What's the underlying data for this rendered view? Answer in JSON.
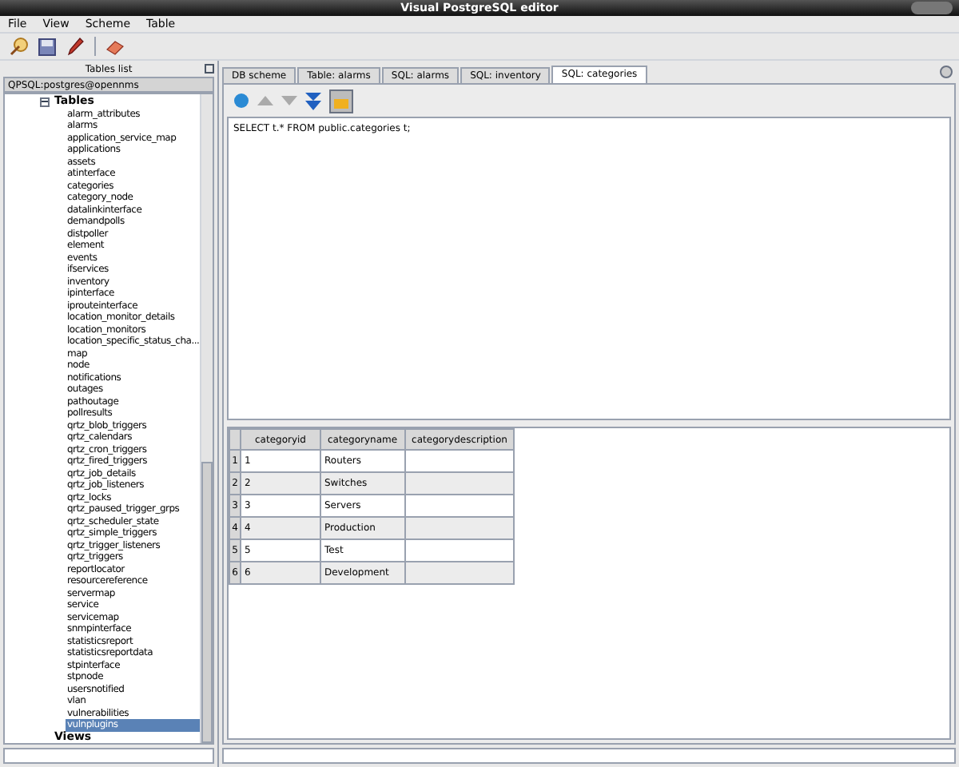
{
  "window": {
    "title": "Visual PostgreSQL editor"
  },
  "menu": [
    "File",
    "View",
    "Scheme",
    "Table"
  ],
  "sidebar": {
    "title": "Tables list",
    "connection": "QPSQL:postgres@opennms",
    "tree": [
      {
        "label": "Tables",
        "expanded": true,
        "children": [
          {
            "label": "alarm_attributes",
            "selected": false
          },
          {
            "label": "alarms",
            "selected": false
          },
          {
            "label": "application_service_map",
            "selected": false
          },
          {
            "label": "applications",
            "selected": false
          },
          {
            "label": "assets",
            "selected": false
          },
          {
            "label": "atinterface",
            "selected": false
          },
          {
            "label": "categories",
            "selected": false
          },
          {
            "label": "category_node",
            "selected": false
          },
          {
            "label": "datalinkinterface",
            "selected": false
          },
          {
            "label": "demandpolls",
            "selected": false
          },
          {
            "label": "distpoller",
            "selected": false
          },
          {
            "label": "element",
            "selected": false
          },
          {
            "label": "events",
            "selected": false
          },
          {
            "label": "ifservices",
            "selected": false
          },
          {
            "label": "inventory",
            "selected": false
          },
          {
            "label": "ipinterface",
            "selected": false
          },
          {
            "label": "iprouteinterface",
            "selected": false
          },
          {
            "label": "location_monitor_details",
            "selected": false
          },
          {
            "label": "location_monitors",
            "selected": false
          },
          {
            "label": "location_specific_status_cha...",
            "selected": false
          },
          {
            "label": "map",
            "selected": false
          },
          {
            "label": "node",
            "selected": false
          },
          {
            "label": "notifications",
            "selected": false
          },
          {
            "label": "outages",
            "selected": false
          },
          {
            "label": "pathoutage",
            "selected": false
          },
          {
            "label": "pollresults",
            "selected": false
          },
          {
            "label": "qrtz_blob_triggers",
            "selected": false
          },
          {
            "label": "qrtz_calendars",
            "selected": false
          },
          {
            "label": "qrtz_cron_triggers",
            "selected": false
          },
          {
            "label": "qrtz_fired_triggers",
            "selected": false
          },
          {
            "label": "qrtz_job_details",
            "selected": false
          },
          {
            "label": "qrtz_job_listeners",
            "selected": false
          },
          {
            "label": "qrtz_locks",
            "selected": false
          },
          {
            "label": "qrtz_paused_trigger_grps",
            "selected": false
          },
          {
            "label": "qrtz_scheduler_state",
            "selected": false
          },
          {
            "label": "qrtz_simple_triggers",
            "selected": false
          },
          {
            "label": "qrtz_trigger_listeners",
            "selected": false
          },
          {
            "label": "qrtz_triggers",
            "selected": false
          },
          {
            "label": "reportlocator",
            "selected": false
          },
          {
            "label": "resourcereference",
            "selected": false
          },
          {
            "label": "servermap",
            "selected": false
          },
          {
            "label": "service",
            "selected": false
          },
          {
            "label": "servicemap",
            "selected": false
          },
          {
            "label": "snmpinterface",
            "selected": false
          },
          {
            "label": "statisticsreport",
            "selected": false
          },
          {
            "label": "statisticsreportdata",
            "selected": false
          },
          {
            "label": "stpinterface",
            "selected": false
          },
          {
            "label": "stpnode",
            "selected": false
          },
          {
            "label": "usersnotified",
            "selected": false
          },
          {
            "label": "vlan",
            "selected": false
          },
          {
            "label": "vulnerabilities",
            "selected": false
          },
          {
            "label": "vulnplugins",
            "selected": true
          }
        ]
      },
      {
        "label": "Views",
        "expanded": false
      }
    ]
  },
  "tabs": [
    {
      "label": "DB scheme",
      "selected": false
    },
    {
      "label": "Table: alarms",
      "selected": false
    },
    {
      "label": "SQL: alarms",
      "selected": false
    },
    {
      "label": "SQL: inventory",
      "selected": false
    },
    {
      "label": "SQL: categories",
      "selected": true
    }
  ],
  "query": "SELECT t.* FROM public.categories t;",
  "table": {
    "columns": [
      "categoryid",
      "categoryname",
      "categorydescription"
    ],
    "rows": [
      {
        "number": "1",
        "cells": [
          "1",
          "Routers",
          ""
        ]
      },
      {
        "number": "2",
        "cells": [
          "2",
          "Switches",
          ""
        ]
      },
      {
        "number": "3",
        "cells": [
          "3",
          "Servers",
          ""
        ]
      },
      {
        "number": "4",
        "cells": [
          "4",
          "Production",
          ""
        ]
      },
      {
        "number": "5",
        "cells": [
          "5",
          "Test",
          ""
        ]
      },
      {
        "number": "6",
        "cells": [
          "6",
          "Development",
          ""
        ]
      }
    ]
  }
}
